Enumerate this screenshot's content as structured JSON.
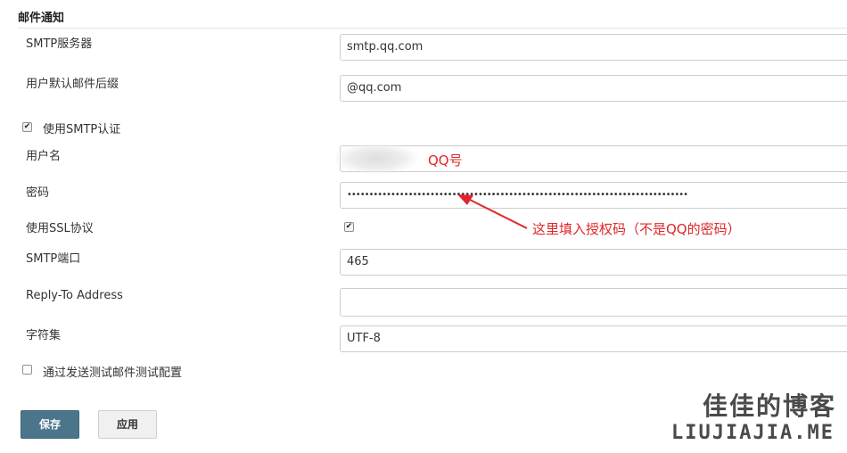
{
  "section": {
    "title": "邮件通知"
  },
  "smtp_server": {
    "label": "SMTP服务器",
    "value": "smtp.qq.com"
  },
  "default_suffix": {
    "label": "用户默认邮件后缀",
    "value": "@qq.com"
  },
  "smtp_auth": {
    "label": "使用SMTP认证",
    "checked": true
  },
  "username": {
    "label": "用户名",
    "value": ""
  },
  "password": {
    "label": "密码",
    "value": "••••••••••••••••••••••••••••••••••••••••••••••••••••••••••••••••••••••••••••••"
  },
  "use_ssl": {
    "label": "使用SSL协议",
    "checked": true
  },
  "smtp_port": {
    "label": "SMTP端口",
    "value": "465"
  },
  "reply_to": {
    "label": "Reply-To Address",
    "value": ""
  },
  "charset": {
    "label": "字符集",
    "value": "UTF-8"
  },
  "test_config": {
    "label": "通过发送测试邮件测试配置",
    "checked": false
  },
  "annotations": {
    "qq_number": "QQ号",
    "auth_code_note": "这里填入授权码（不是QQ的密码）",
    "color": "#e0262a"
  },
  "buttons": {
    "save": "保存",
    "apply": "应用",
    "save_color": "#4b758b"
  },
  "watermark": {
    "chinese": "佳佳的博客",
    "english": "LIUJIAJIA.ME"
  },
  "icons": {
    "checkbox_checked": "checkmark-icon",
    "annotation_arrow": "arrow-icon"
  }
}
